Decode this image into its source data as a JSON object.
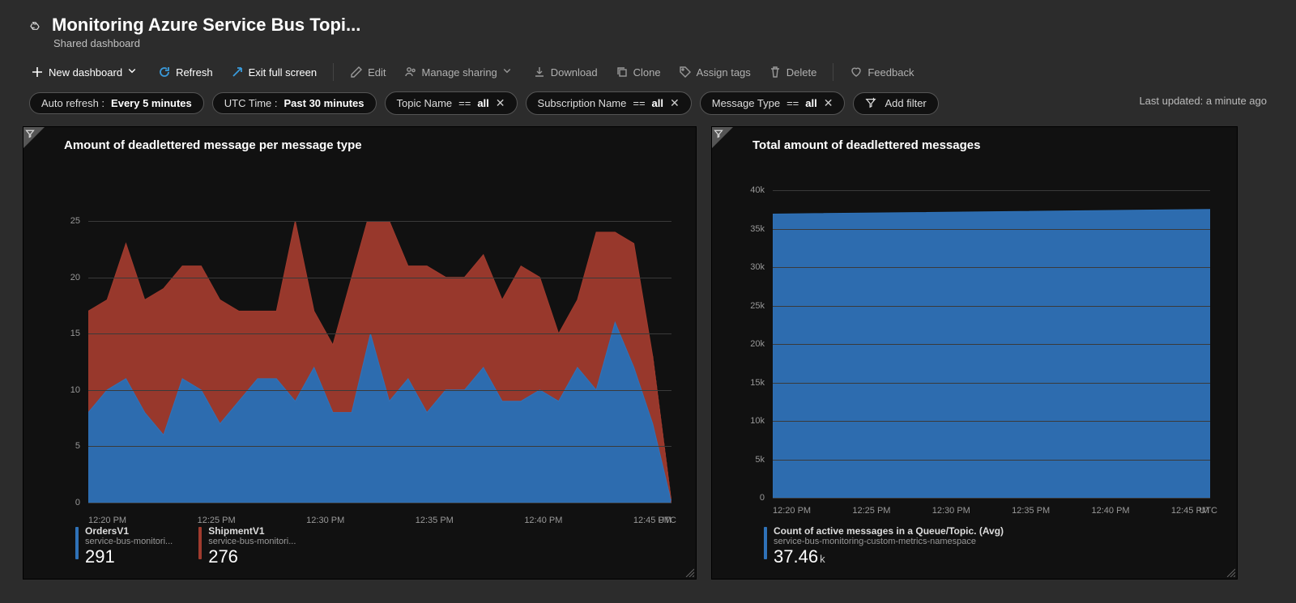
{
  "header": {
    "title": "Monitoring Azure Service Bus Topi...",
    "subtitle": "Shared dashboard"
  },
  "toolbar": {
    "new_dashboard": "New dashboard",
    "refresh": "Refresh",
    "exit_full_screen": "Exit full screen",
    "edit": "Edit",
    "manage_sharing": "Manage sharing",
    "download": "Download",
    "clone": "Clone",
    "assign_tags": "Assign tags",
    "delete": "Delete",
    "feedback": "Feedback"
  },
  "pills": {
    "auto_refresh_label": "Auto refresh : ",
    "auto_refresh_value": "Every 5 minutes",
    "time_label": "UTC Time : ",
    "time_value": "Past 30 minutes",
    "filters": [
      {
        "key": "Topic Name",
        "op": "==",
        "value": "all"
      },
      {
        "key": "Subscription Name",
        "op": "==",
        "value": "all"
      },
      {
        "key": "Message Type",
        "op": "==",
        "value": "all"
      }
    ],
    "add_filter": "Add filter"
  },
  "last_updated": "Last updated: a minute ago",
  "left_tile": {
    "title": "Amount of deadlettered message per message type",
    "legend": [
      {
        "name": "OrdersV1",
        "sub": "service-bus-monitori...",
        "value": "291",
        "color": "#2F72B8"
      },
      {
        "name": "ShipmentV1",
        "sub": "service-bus-monitori...",
        "value": "276",
        "color": "#A03B2E"
      }
    ]
  },
  "right_tile": {
    "title": "Total amount of deadlettered messages",
    "legend": {
      "name": "Count of active messages in a Queue/Topic. (Avg)",
      "sub": "service-bus-monitoring-custom-metrics-namespace",
      "value": "37.46",
      "unit": "k",
      "color": "#2F72B8"
    }
  },
  "timezone_label": "UTC",
  "chart_data": [
    {
      "type": "area",
      "title": "Amount of deadlettered message per message type",
      "xlabel": "",
      "ylabel": "",
      "ylim": [
        0,
        25
      ],
      "y_ticks": [
        0,
        5,
        10,
        15,
        20,
        25
      ],
      "x_ticks": [
        "12:20 PM",
        "12:25 PM",
        "12:30 PM",
        "12:35 PM",
        "12:40 PM",
        "12:45 PM"
      ],
      "x": [
        "12:18",
        "12:19",
        "12:20",
        "12:21",
        "12:22",
        "12:23",
        "12:24",
        "12:25",
        "12:26",
        "12:27",
        "12:28",
        "12:29",
        "12:30",
        "12:31",
        "12:32",
        "12:33",
        "12:34",
        "12:35",
        "12:36",
        "12:37",
        "12:38",
        "12:39",
        "12:40",
        "12:41",
        "12:42",
        "12:43",
        "12:44",
        "12:45",
        "12:46",
        "12:47",
        "12:48",
        "12:49"
      ],
      "series": [
        {
          "name": "OrdersV1",
          "color": "#2F72B8",
          "values": [
            8,
            10,
            11,
            8,
            6,
            11,
            10,
            7,
            9,
            11,
            11,
            9,
            12,
            8,
            8,
            15,
            9,
            11,
            8,
            10,
            10,
            12,
            9,
            9,
            10,
            9,
            12,
            10,
            16,
            12,
            7,
            0
          ]
        },
        {
          "name": "ShipmentV1",
          "color": "#A03B2E",
          "values": [
            9,
            8,
            12,
            10,
            13,
            10,
            11,
            11,
            8,
            6,
            6,
            16,
            5,
            6,
            12,
            11,
            16,
            10,
            13,
            10,
            10,
            10,
            9,
            12,
            10,
            6,
            6,
            14,
            8,
            11,
            6,
            0
          ]
        }
      ],
      "stacked": true
    },
    {
      "type": "area",
      "title": "Total amount of deadlettered messages",
      "xlabel": "",
      "ylabel": "",
      "ylim": [
        0,
        40000
      ],
      "y_ticks": [
        0,
        5000,
        10000,
        15000,
        20000,
        25000,
        30000,
        35000,
        40000
      ],
      "y_tick_labels": [
        "0",
        "5k",
        "10k",
        "15k",
        "20k",
        "25k",
        "30k",
        "35k",
        "40k"
      ],
      "x_ticks": [
        "12:20 PM",
        "12:25 PM",
        "12:30 PM",
        "12:35 PM",
        "12:40 PM",
        "12:45 PM"
      ],
      "x": [
        "12:18",
        "12:49"
      ],
      "series": [
        {
          "name": "Count of active messages in a Queue/Topic. (Avg)",
          "color": "#2F72B8",
          "values": [
            36900,
            37500
          ]
        }
      ]
    }
  ]
}
